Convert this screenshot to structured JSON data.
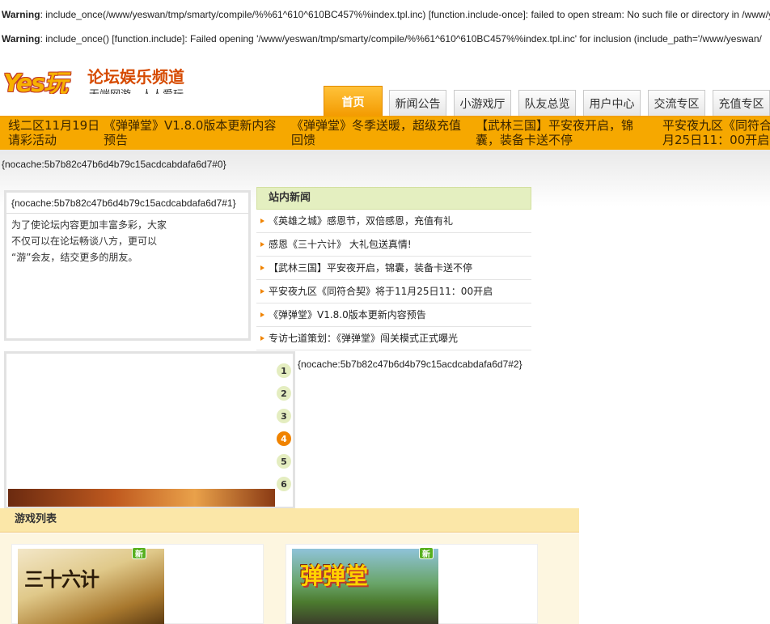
{
  "warnings": [
    {
      "label": "Warning",
      "text": ": include_once(/www/yeswan/tmp/smarty/compile/%%61^610^610BC457%%index.tpl.inc) [function.include-once]: failed to open stream: No such file or directory in /www/yesw"
    },
    {
      "label": "Warning",
      "text": ": include_once() [function.include]: Failed opening '/www/yeswan/tmp/smarty/compile/%%61^610^610BC457%%index.tpl.inc' for inclusion (include_path='/www/yeswan/"
    }
  ],
  "logo": {
    "mark": "Yes玩",
    "tagline": "论坛娱乐频道",
    "sub": "无端网游，人人爱玩"
  },
  "nav": {
    "tabs": [
      "首页",
      "新闻公告",
      "小游戏厅",
      "队友总览",
      "用户中心",
      "交流专区",
      "充值专区"
    ]
  },
  "ticker": [
    {
      "line1": "线二区11月19日",
      "line2": "请彩活动"
    },
    {
      "line1": "《弹弹堂》V1.8.0版本更新内容",
      "line2": "预告"
    },
    {
      "line1": "《弹弹堂》冬季送暖，超级充值",
      "line2": "回馈"
    },
    {
      "line1": "【武林三国】平安夜开启，锦",
      "line2": "囊，装备卡送不停"
    },
    {
      "line1": "平安夜九区《同符合",
      "line2": "月25日11：00开启"
    }
  ],
  "nocache0": "{nocache:5b7b82c47b6d4b79c15acdcabdafa6d7#0}",
  "intro": {
    "nocache": "{nocache:5b7b82c47b6d4b79c15acdcabdafa6d7#1}",
    "lines": [
      "为了使论坛内容更加丰富多彩，大家",
      "不仅可以在论坛畅谈八方，更可以",
      "“游”会友，结交更多的朋友。"
    ]
  },
  "news": {
    "title": "站内新闻",
    "items": [
      "《英雄之城》感恩节，双倍感恩，充值有礼",
      "感恩《三十六计》 大礼包送真情!",
      "【武林三国】平安夜开启，锦囊，装备卡送不停",
      "平安夜九区《同符合契》将于11月25日11：00开启",
      "《弹弹堂》V1.8.0版本更新内容预告",
      "专访七道策划：《弹弹堂》闯关模式正式曝光"
    ]
  },
  "nocache2": "{nocache:5b7b82c47b6d4b79c15acdcabdafa6d7#2}",
  "slideshow": {
    "pages": [
      "1",
      "2",
      "3",
      "4",
      "5",
      "6"
    ],
    "active_index": 3
  },
  "game_list": {
    "title": "游戏列表",
    "games": [
      {
        "art_title": "三十六计",
        "badge": "新"
      },
      {
        "art_title": "弹弹堂",
        "badge": "新"
      }
    ]
  },
  "colors": {
    "accent": "#f6a800",
    "nav_active": "#f39a00",
    "news_header": "#e4efc0",
    "game_header": "#fbe7a8",
    "slide_active": "#f08300"
  }
}
